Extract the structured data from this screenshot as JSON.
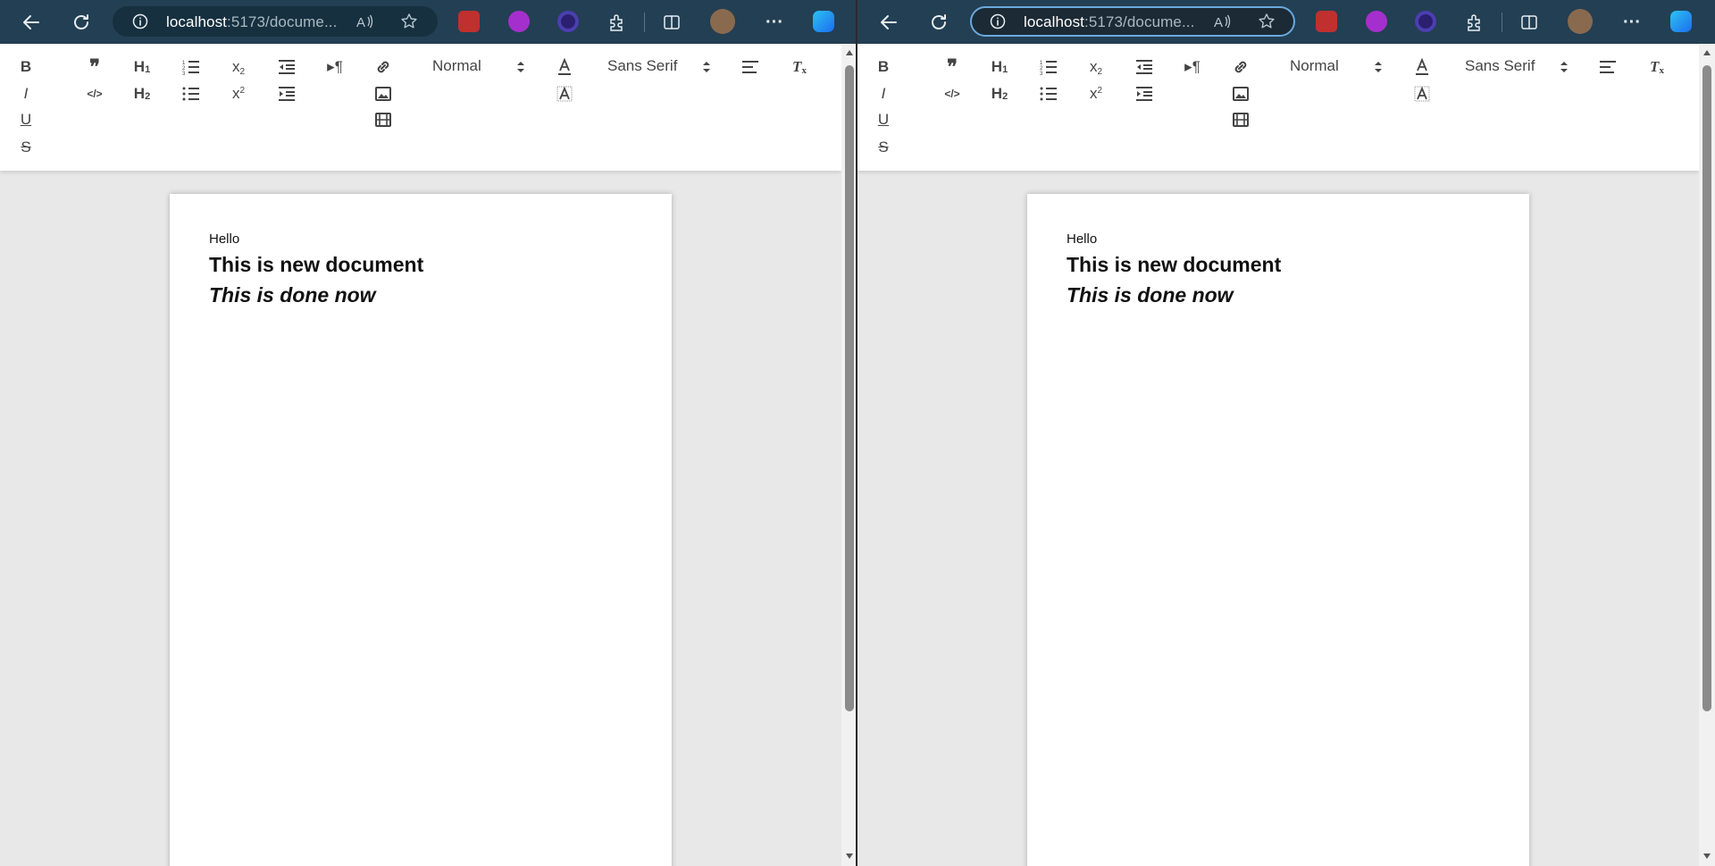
{
  "browser": {
    "url_host": "localhost",
    "url_rest": ":5173/docume...",
    "more_label": "···"
  },
  "editor": {
    "header_select": "Normal",
    "font_select": "Sans Serif"
  },
  "document": {
    "lines": [
      "Hello",
      "This is new document",
      "This is done now"
    ]
  },
  "colors": {
    "browser_bar": "#233f53",
    "address_bg": "#16303f",
    "focus_ring": "#6aa9dd",
    "canvas_bg": "#e8e8e8"
  }
}
